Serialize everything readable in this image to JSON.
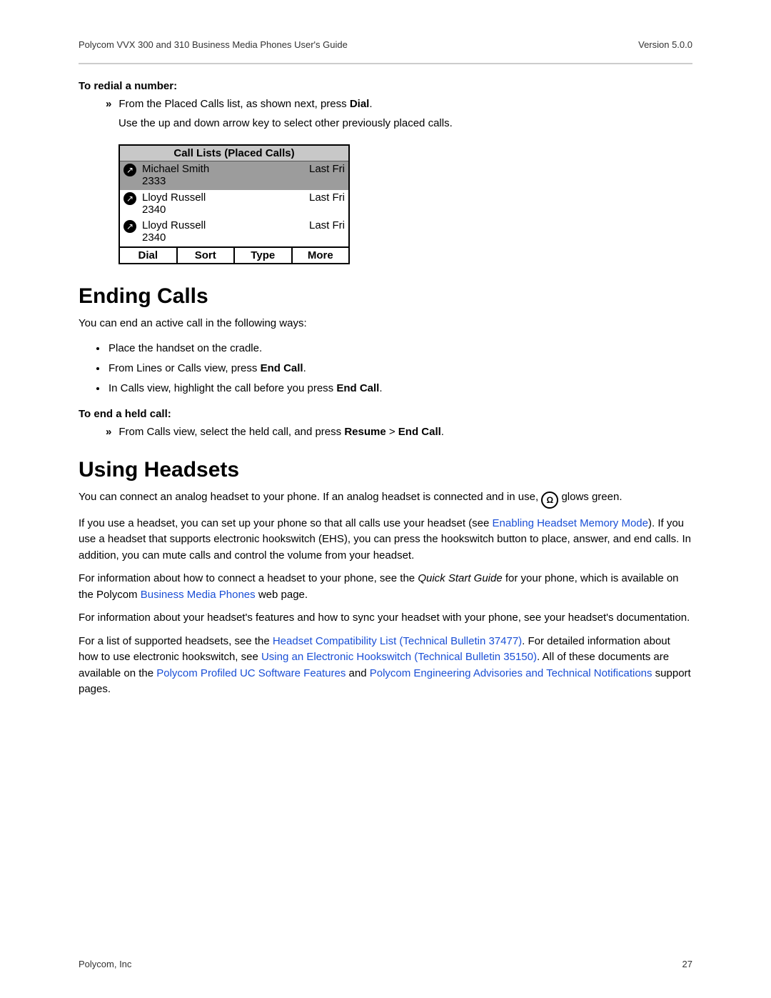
{
  "header": {
    "title": "Polycom VVX 300 and 310 Business Media Phones User's Guide",
    "version": "Version 5.0.0"
  },
  "redial": {
    "label": "To redial a number:",
    "marker": "»",
    "step_a": "From the Placed Calls list, as shown next, press ",
    "step_bold": "Dial",
    "step_sub": "Use the up and down arrow key to select other previously placed calls."
  },
  "phone": {
    "title": "Call Lists (Placed Calls)",
    "rows": [
      {
        "name": "Michael Smith",
        "num": "2333",
        "time": "Last Fri",
        "selected": true
      },
      {
        "name": "Lloyd Russell",
        "num": "2340",
        "time": "Last Fri",
        "selected": false
      },
      {
        "name": "Lloyd Russell",
        "num": "2340",
        "time": "Last Fri",
        "selected": false
      }
    ],
    "soft": [
      "Dial",
      "Sort",
      "Type",
      "More"
    ]
  },
  "ending": {
    "heading": "Ending Calls",
    "intro": "You can end an active call in the following ways:",
    "bullets": {
      "b1": "Place the handset on the cradle.",
      "b2a": "From Lines or Calls view, press ",
      "b2bold": "End Call",
      "b3a": "In Calls view, highlight the call before you press ",
      "b3bold": "End Call"
    },
    "held_label": "To end a held call:",
    "held_marker": "»",
    "held_a": "From Calls view, select the held call, and press ",
    "held_bold1": "Resume",
    "held_gt": " > ",
    "held_bold2": "End Call"
  },
  "headsets": {
    "heading": "Using Headsets",
    "p1a": "You can connect an analog headset to your phone. If an analog headset is connected and in use, ",
    "p1b": " glows green.",
    "p2a": "If you use a headset, you can set up your phone so that all calls use your headset (see ",
    "p2link": "Enabling Headset Memory Mode",
    "p2b": "). If you use a headset that supports electronic hookswitch (EHS), you can press the hookswitch button to place, answer, and end calls. In addition, you can mute calls and control the volume from your headset.",
    "p3a": "For information about how to connect a headset to your phone, see the ",
    "p3italic": "Quick Start Guide",
    "p3b": " for your phone, which is available on the Polycom ",
    "p3link": "Business Media Phones",
    "p3c": " web page.",
    "p4": "For information about your headset's features and how to sync your headset with your phone, see your headset's documentation.",
    "p5a": "For a list of supported headsets, see the ",
    "p5link1": "Headset Compatibility List (Technical Bulletin 37477)",
    "p5b": ". For detailed information about how to use electronic hookswitch, see ",
    "p5link2": "Using an Electronic Hookswitch (Technical Bulletin 35150)",
    "p5c": ". All of these documents are available on the ",
    "p5link3": "Polycom Profiled UC Software Features",
    "p5d": " and ",
    "p5link4": "Polycom Engineering Advisories and Technical Notifications",
    "p5e": " support pages."
  },
  "footer": {
    "company": "Polycom, Inc",
    "page": "27"
  }
}
